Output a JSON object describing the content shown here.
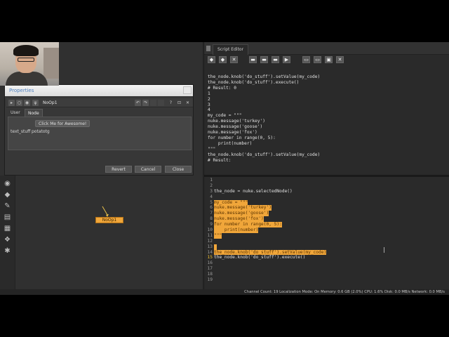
{
  "properties": {
    "title": "Properties",
    "node_name": "NoOp1",
    "tabs": [
      "User",
      "Node"
    ],
    "button_label": "Click Me for Awesome!",
    "knob_label": "text_stuff",
    "knob_value": "potatotg",
    "footer": {
      "revert": "Revert",
      "cancel": "Cancel",
      "close": "Close"
    }
  },
  "node_graph": {
    "node_label": "NoOp1",
    "node_color": "#f0a63a"
  },
  "script_editor": {
    "tab_label": "Script Editor",
    "output_lines": [
      "the_node.knob('do_stuff').setValue(my_code)",
      "the_node.knob('do_stuff').execute()",
      "# Result: 0",
      "1",
      "2",
      "3",
      "4",
      "my_code = \"\"\"",
      "nuke.message('turkey')",
      "nuke.message('goose')",
      "nuke.message('fox')",
      "for number in range(0, 5):",
      "    print(number)",
      "\"\"\"",
      "",
      "",
      "the_node.knob('do_stuff').setValue(my_code)",
      "# Result:"
    ],
    "input_lines": [
      {
        "n": "1",
        "code": ""
      },
      {
        "n": "2",
        "code": ""
      },
      {
        "n": "3",
        "code": "the_node = nuke.selectedNode()"
      },
      {
        "n": "4",
        "code": ""
      },
      {
        "n": "5",
        "code": "my_code = \"\"\""
      },
      {
        "n": "6",
        "code": "nuke.message('turkey')"
      },
      {
        "n": "7",
        "code": "nuke.message('goose')"
      },
      {
        "n": "8",
        "code": "nuke.message('fox')"
      },
      {
        "n": "9",
        "code": "for number in range(0, 5):"
      },
      {
        "n": "10",
        "code": "    print(number)"
      },
      {
        "n": "11",
        "code": "\"\"\""
      },
      {
        "n": "12",
        "code": ""
      },
      {
        "n": "13",
        "code": ""
      },
      {
        "n": "14",
        "code": "the_node.knob('do_stuff').setValue(my_code)"
      },
      {
        "n": "15",
        "code": "the_node.knob('do_stuff').execute()"
      },
      {
        "n": "16",
        "code": ""
      },
      {
        "n": "17",
        "code": ""
      },
      {
        "n": "18",
        "code": ""
      },
      {
        "n": "19",
        "code": ""
      }
    ],
    "highlighted_lines": [
      "5",
      "6",
      "7",
      "8",
      "9",
      "10",
      "11",
      "13",
      "14"
    ],
    "active_line": "15",
    "highlight_color": "#f0a63a"
  },
  "status_bar": {
    "text": "Channel Count: 19  Localization Mode: On  Memory: 0.6 GB (2.0%)  CPU: 1.6%  Disk: 0.0 MB/s  Network: 0.0 MB/s"
  }
}
